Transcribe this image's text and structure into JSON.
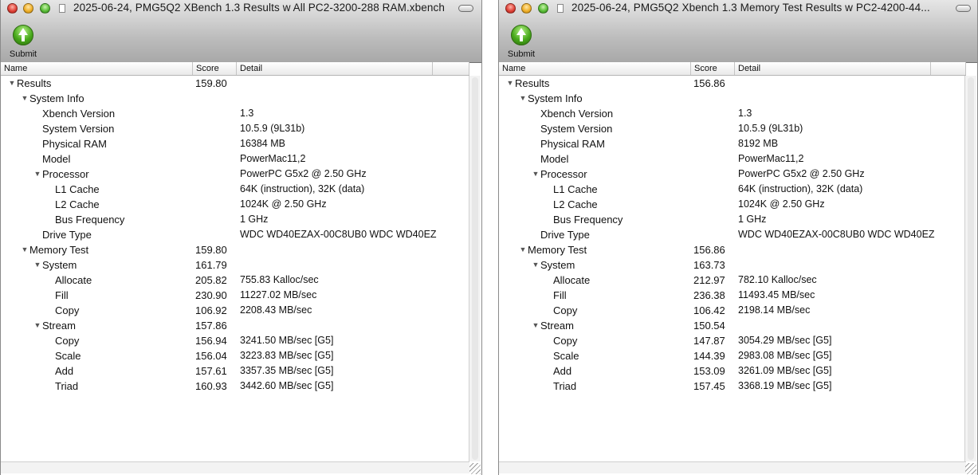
{
  "windows": [
    {
      "id": "left",
      "title": "2025-06-24, PMG5Q2 XBench 1.3 Results w All PC2-3200-288 RAM.xbench",
      "toolbar": {
        "submit_label": "Submit"
      },
      "columns": {
        "name": "Name",
        "score": "Score",
        "detail": "Detail"
      },
      "rows": [
        {
          "level": 0,
          "expanded": true,
          "name": "Results",
          "score": "159.80",
          "detail": ""
        },
        {
          "level": 1,
          "expanded": true,
          "name": "System Info",
          "score": "",
          "detail": ""
        },
        {
          "level": 2,
          "expanded": null,
          "name": "Xbench Version",
          "score": "",
          "detail": "1.3"
        },
        {
          "level": 2,
          "expanded": null,
          "name": "System Version",
          "score": "",
          "detail": "10.5.9 (9L31b)"
        },
        {
          "level": 2,
          "expanded": null,
          "name": "Physical RAM",
          "score": "",
          "detail": "16384 MB"
        },
        {
          "level": 2,
          "expanded": null,
          "name": "Model",
          "score": "",
          "detail": "PowerMac11,2"
        },
        {
          "level": 2,
          "expanded": true,
          "name": "Processor",
          "score": "",
          "detail": "PowerPC G5x2 @ 2.50 GHz"
        },
        {
          "level": 3,
          "expanded": null,
          "name": "L1 Cache",
          "score": "",
          "detail": "64K (instruction), 32K (data)"
        },
        {
          "level": 3,
          "expanded": null,
          "name": "L2 Cache",
          "score": "",
          "detail": "1024K @ 2.50 GHz"
        },
        {
          "level": 3,
          "expanded": null,
          "name": "Bus Frequency",
          "score": "",
          "detail": "1 GHz"
        },
        {
          "level": 2,
          "expanded": null,
          "name": "Drive Type",
          "score": "",
          "detail": "WDC WD40EZAX-00C8UB0 WDC WD40EZ"
        },
        {
          "level": 1,
          "expanded": true,
          "name": "Memory Test",
          "score": "159.80",
          "detail": ""
        },
        {
          "level": 2,
          "expanded": true,
          "name": "System",
          "score": "161.79",
          "detail": ""
        },
        {
          "level": 3,
          "expanded": null,
          "name": "Allocate",
          "score": "205.82",
          "detail": "755.83 Kalloc/sec"
        },
        {
          "level": 3,
          "expanded": null,
          "name": "Fill",
          "score": "230.90",
          "detail": "11227.02 MB/sec"
        },
        {
          "level": 3,
          "expanded": null,
          "name": "Copy",
          "score": "106.92",
          "detail": "2208.43 MB/sec"
        },
        {
          "level": 2,
          "expanded": true,
          "name": "Stream",
          "score": "157.86",
          "detail": ""
        },
        {
          "level": 3,
          "expanded": null,
          "name": "Copy",
          "score": "156.94",
          "detail": "3241.50 MB/sec [G5]"
        },
        {
          "level": 3,
          "expanded": null,
          "name": "Scale",
          "score": "156.04",
          "detail": "3223.83 MB/sec [G5]"
        },
        {
          "level": 3,
          "expanded": null,
          "name": "Add",
          "score": "157.61",
          "detail": "3357.35 MB/sec [G5]"
        },
        {
          "level": 3,
          "expanded": null,
          "name": "Triad",
          "score": "160.93",
          "detail": "3442.60 MB/sec [G5]"
        }
      ]
    },
    {
      "id": "right",
      "title": "2025-06-24, PMG5Q2 Xbench 1.3 Memory Test Results w PC2-4200-44...",
      "toolbar": {
        "submit_label": "Submit"
      },
      "columns": {
        "name": "Name",
        "score": "Score",
        "detail": "Detail"
      },
      "rows": [
        {
          "level": 0,
          "expanded": true,
          "name": "Results",
          "score": "156.86",
          "detail": ""
        },
        {
          "level": 1,
          "expanded": true,
          "name": "System Info",
          "score": "",
          "detail": ""
        },
        {
          "level": 2,
          "expanded": null,
          "name": "Xbench Version",
          "score": "",
          "detail": "1.3"
        },
        {
          "level": 2,
          "expanded": null,
          "name": "System Version",
          "score": "",
          "detail": "10.5.9 (9L31b)"
        },
        {
          "level": 2,
          "expanded": null,
          "name": "Physical RAM",
          "score": "",
          "detail": "8192 MB"
        },
        {
          "level": 2,
          "expanded": null,
          "name": "Model",
          "score": "",
          "detail": "PowerMac11,2"
        },
        {
          "level": 2,
          "expanded": true,
          "name": "Processor",
          "score": "",
          "detail": "PowerPC G5x2 @ 2.50 GHz"
        },
        {
          "level": 3,
          "expanded": null,
          "name": "L1 Cache",
          "score": "",
          "detail": "64K (instruction), 32K (data)"
        },
        {
          "level": 3,
          "expanded": null,
          "name": "L2 Cache",
          "score": "",
          "detail": "1024K @ 2.50 GHz"
        },
        {
          "level": 3,
          "expanded": null,
          "name": "Bus Frequency",
          "score": "",
          "detail": "1 GHz"
        },
        {
          "level": 2,
          "expanded": null,
          "name": "Drive Type",
          "score": "",
          "detail": "WDC WD40EZAX-00C8UB0 WDC WD40EZ"
        },
        {
          "level": 1,
          "expanded": true,
          "name": "Memory Test",
          "score": "156.86",
          "detail": ""
        },
        {
          "level": 2,
          "expanded": true,
          "name": "System",
          "score": "163.73",
          "detail": ""
        },
        {
          "level": 3,
          "expanded": null,
          "name": "Allocate",
          "score": "212.97",
          "detail": "782.10 Kalloc/sec"
        },
        {
          "level": 3,
          "expanded": null,
          "name": "Fill",
          "score": "236.38",
          "detail": "11493.45 MB/sec"
        },
        {
          "level": 3,
          "expanded": null,
          "name": "Copy",
          "score": "106.42",
          "detail": "2198.14 MB/sec"
        },
        {
          "level": 2,
          "expanded": true,
          "name": "Stream",
          "score": "150.54",
          "detail": ""
        },
        {
          "level": 3,
          "expanded": null,
          "name": "Copy",
          "score": "147.87",
          "detail": "3054.29 MB/sec [G5]"
        },
        {
          "level": 3,
          "expanded": null,
          "name": "Scale",
          "score": "144.39",
          "detail": "2983.08 MB/sec [G5]"
        },
        {
          "level": 3,
          "expanded": null,
          "name": "Add",
          "score": "153.09",
          "detail": "3261.09 MB/sec [G5]"
        },
        {
          "level": 3,
          "expanded": null,
          "name": "Triad",
          "score": "157.45",
          "detail": "3368.19 MB/sec [G5]"
        }
      ]
    }
  ],
  "icons": {
    "disclosure_expanded": "▼",
    "close": "close-icon",
    "minimize": "minimize-icon",
    "zoom": "zoom-icon",
    "document": "document-icon",
    "submit": "submit-arrow-up-icon"
  }
}
